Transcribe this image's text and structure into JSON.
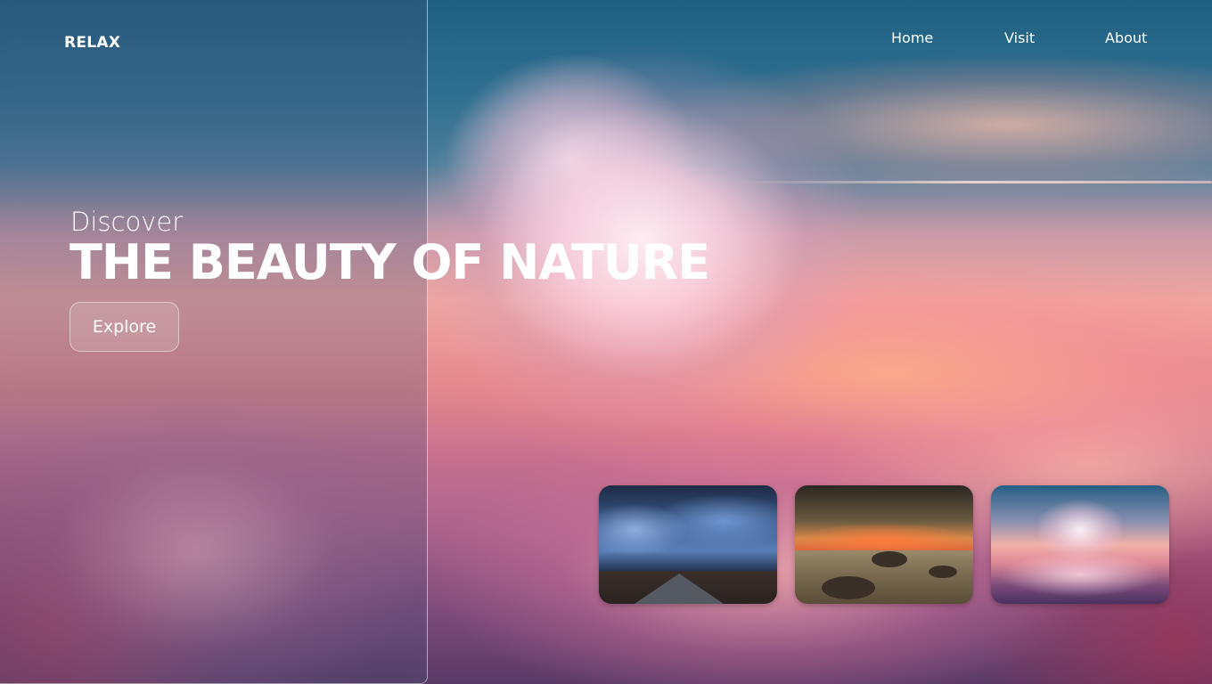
{
  "brand": {
    "logo_text": "RELAX"
  },
  "nav": {
    "items": [
      {
        "label": "Home"
      },
      {
        "label": "Visit"
      },
      {
        "label": "About"
      }
    ]
  },
  "hero": {
    "kicker": "Discover",
    "headline": "THE BEAUTY OF NATURE",
    "cta_label": "Explore"
  },
  "gallery": {
    "cards": [
      {
        "subject": "stormy sky over road"
      },
      {
        "subject": "sunset over rocky shore"
      },
      {
        "subject": "pink clouds at dusk"
      }
    ]
  },
  "colors": {
    "text": "#ffffff",
    "sky_top": "#1f5f82",
    "sky_pink": "#f0a6a0"
  }
}
